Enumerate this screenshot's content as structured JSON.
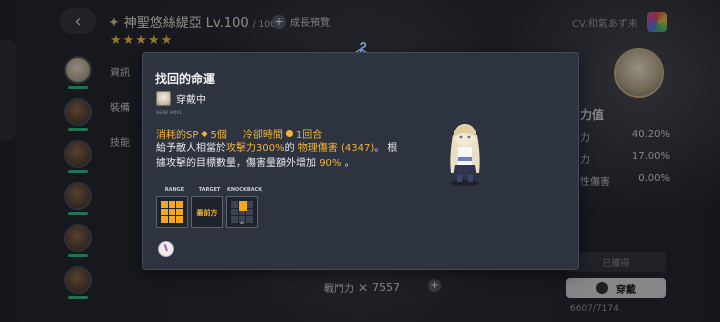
{
  "background": {
    "character_name": "神聖悠絲緹亞",
    "level": "Lv.100",
    "level_max": "/ 100",
    "growth_preview": "成長預覽",
    "stars": "★★★★★",
    "cv": "CV.和氣あず未",
    "side_tabs": [
      "資訊",
      "裝備",
      "技能"
    ],
    "stats_header": "力值",
    "stats": [
      {
        "label": "力",
        "value": "40.20%"
      },
      {
        "label": "力",
        "value": "17.00%"
      },
      {
        "label": "性傷害",
        "value": "0.00%"
      }
    ],
    "obtained_label": "已獲得",
    "equip_label": "穿戴",
    "hp_text": "6607/7174",
    "power_label": "戰鬥力",
    "power_value": "7557"
  },
  "modal": {
    "title": "找回的命運",
    "equip_status": "穿戴中",
    "caption": "GEAR HOVL",
    "cost_label": "消耗的SP",
    "cost_value": "5個",
    "cooldown_label": "冷卻時間",
    "cooldown_value": "1回合",
    "desc_1": "給予敵人相當於",
    "desc_hl_1": "攻擊力300%",
    "desc_2": "的",
    "desc_hl_2": "物理傷害",
    "desc_hl_3": "(4347)",
    "desc_3": "。 根據攻擊的目標數量，傷害量額外增加",
    "desc_hl_4": "90%",
    "desc_4": "。",
    "labels": {
      "range": "RANGE",
      "target": "TARGET",
      "knockback": "KNOCKBACK"
    },
    "target_text": "最前方"
  },
  "colors": {
    "accent": "#f1b43a",
    "modal_bg": "#2d3440",
    "highlight_grid": "#f1a81f"
  },
  "icons": [
    "hanger-icon",
    "close-icon",
    "clock-icon",
    "back-arrow-icon"
  ]
}
